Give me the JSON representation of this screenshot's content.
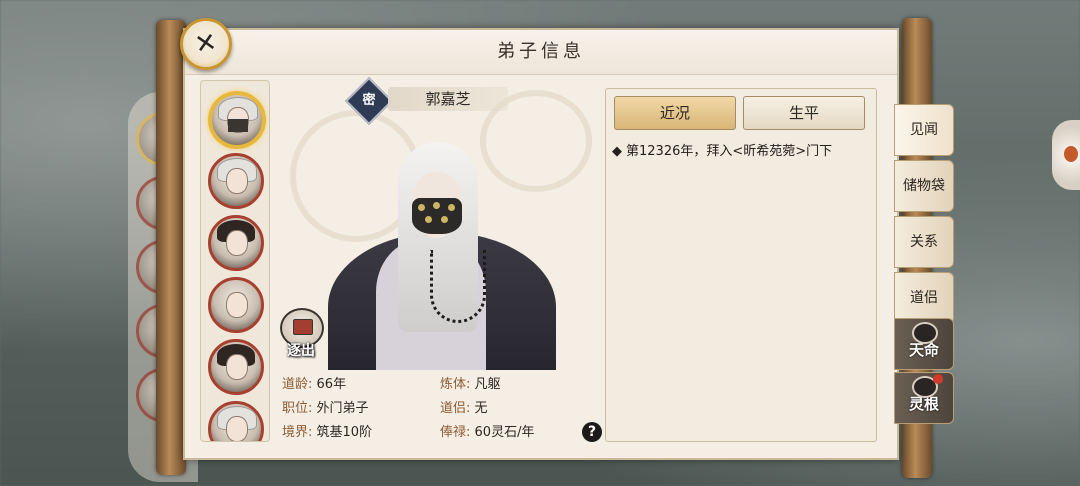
{
  "panel": {
    "title": "弟子信息"
  },
  "character": {
    "name": "郭嘉芝",
    "emblem_glyph": "密",
    "stats": [
      {
        "key": "道龄:",
        "value": "66年"
      },
      {
        "key": "炼体:",
        "value": "凡躯"
      },
      {
        "key": "职位:",
        "value": "外门弟子"
      },
      {
        "key": "道侣:",
        "value": "无"
      },
      {
        "key": "境界:",
        "value": "筑基10阶"
      },
      {
        "key": "俸禄:",
        "value": "60灵石/年"
      }
    ]
  },
  "actions": {
    "expel_label": "逐出",
    "help_glyph": "?",
    "close_glyph": "✕"
  },
  "info_tabs": [
    {
      "label": "近况",
      "active": true
    },
    {
      "label": "生平",
      "active": false
    }
  ],
  "events": [
    {
      "text": "第12326年，拜入<昕希苑菀>门下"
    }
  ],
  "side_tabs": [
    "见闻",
    "储物袋",
    "关系",
    "道侣",
    "天命",
    "灵根"
  ],
  "event_bullet": "◆"
}
